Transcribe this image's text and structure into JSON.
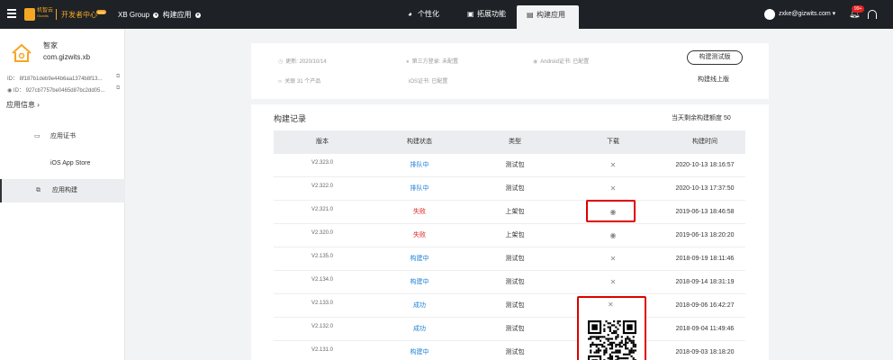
{
  "header": {
    "logo_main": "机智云",
    "logo_sub": "Gizwits",
    "dev_center": "开发者中心",
    "new_badge": "new",
    "breadcrumb_org": "XB Group",
    "breadcrumb_app": "构建应用",
    "tabs": [
      {
        "label": "个性化",
        "icon": "palette-icon"
      },
      {
        "label": "拓展功能",
        "icon": "extension-icon"
      },
      {
        "label": "构建应用",
        "icon": "build-icon"
      }
    ],
    "active_tab": 2,
    "user": "zxke@gizwits.com ▾",
    "notification_badge": "99+"
  },
  "sidebar": {
    "app_name": "智家",
    "app_package": "com.gizwits.xb",
    "ios_id": "ID： 8f187b1deb9e44b6aa1374b8f13...",
    "android_id": "ID： 927cb7757be0465d87bc2dd05...",
    "app_info_label": "应用信息 ›",
    "items": [
      {
        "label": "应用证书",
        "icon": "certificate-icon"
      },
      {
        "label": "iOS App Store",
        "icon": "apple-icon"
      },
      {
        "label": "应用构建",
        "icon": "copy-icon"
      }
    ],
    "active_item": 2
  },
  "info": {
    "updated": "更新: 2020/10/14",
    "third_party": "第三方登录: 未配置",
    "android_cert": "Android证书: 已配置",
    "linked": "关联 31 个产品",
    "ios_cert": "iOS证书: 已配置",
    "build_test_label": "构建测试版",
    "build_release_label": "构建线上版"
  },
  "records": {
    "title": "构建记录",
    "quota": "当天剩余构建额度 50",
    "columns": [
      "版本",
      "构建状态",
      "类型",
      "下载",
      "构建时间"
    ],
    "rows": [
      {
        "version": "V2.323.0",
        "status": "排队中",
        "status_color": "blue",
        "type": "测试包",
        "download": "close",
        "time": "2020-10-13 18:16:57"
      },
      {
        "version": "V2.322.0",
        "status": "排队中",
        "status_color": "blue",
        "type": "测试包",
        "download": "close",
        "time": "2020-10-13 17:37:50"
      },
      {
        "version": "V2.321.0",
        "status": "失败",
        "status_color": "red",
        "type": "上架包",
        "download": "platform",
        "time": "2019-06-13 18:46:58"
      },
      {
        "version": "V2.320.0",
        "status": "失败",
        "status_color": "red",
        "type": "上架包",
        "download": "platform",
        "time": "2019-06-13 18:20:20"
      },
      {
        "version": "V2.135.0",
        "status": "构建中",
        "status_color": "blue",
        "type": "测试包",
        "download": "close",
        "time": "2018-09-19 18:11:46"
      },
      {
        "version": "V2.134.0",
        "status": "构建中",
        "status_color": "blue",
        "type": "测试包",
        "download": "close",
        "time": "2018-09-14 18:31:19"
      },
      {
        "version": "V2.133.0",
        "status": "成功",
        "status_color": "blue",
        "type": "测试包",
        "download": "close",
        "time": "2018-09-06 16:42:27"
      },
      {
        "version": "V2.132.0",
        "status": "成功",
        "status_color": "blue",
        "type": "测试包",
        "download": "",
        "time": "2018-09-04 11:49:46"
      },
      {
        "version": "V2.131.0",
        "status": "构建中",
        "status_color": "blue",
        "type": "测试包",
        "download": "",
        "time": "2018-09-03 18:18:20"
      }
    ]
  },
  "colors": {
    "topbar": "#1e2227",
    "accent": "#f5a623",
    "status_blue": "#1a7fd4",
    "status_red": "#e02020",
    "highlight": "#dd0000"
  }
}
